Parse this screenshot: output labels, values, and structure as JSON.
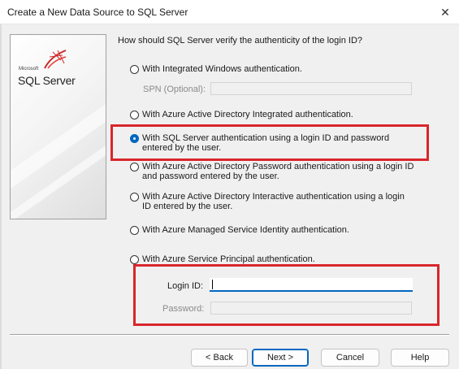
{
  "window": {
    "title": "Create a New Data Source to SQL Server",
    "close_glyph": "✕"
  },
  "logo": {
    "microsoft": "Microsoft",
    "product": "SQL Server"
  },
  "question": "How should SQL Server verify the authenticity of the login ID?",
  "options": [
    {
      "label": "With Integrated Windows authentication.",
      "selected": false
    },
    {
      "label": "With Azure Active Directory Integrated authentication.",
      "selected": false
    },
    {
      "label": "With SQL Server authentication using a login ID and password entered by the user.",
      "selected": true
    },
    {
      "label": "With Azure Active Directory Password authentication using a login ID and password entered by the user.",
      "selected": false
    },
    {
      "label": "With Azure Active Directory Interactive authentication using a login ID entered by the user.",
      "selected": false
    },
    {
      "label": "With Azure Managed Service Identity authentication.",
      "selected": false
    },
    {
      "label": "With Azure Service Principal authentication.",
      "selected": false
    }
  ],
  "spn": {
    "label": "SPN (Optional):",
    "value": ""
  },
  "login": {
    "label": "Login ID:",
    "value": ""
  },
  "password": {
    "label": "Password:",
    "value": ""
  },
  "buttons": {
    "back": "< Back",
    "next": "Next >",
    "cancel": "Cancel",
    "help": "Help"
  },
  "colors": {
    "accent": "#0067c0",
    "highlight": "#d9262c",
    "panel": "#f0f0f0"
  }
}
